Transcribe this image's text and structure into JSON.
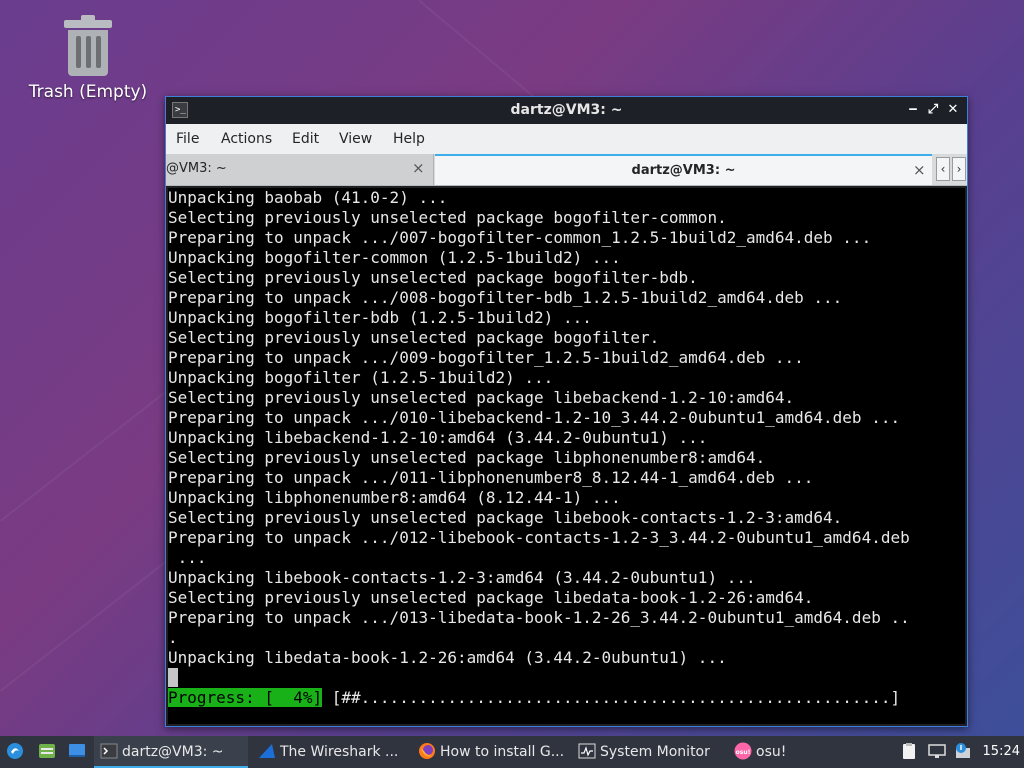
{
  "desktop": {
    "trash_label": "Trash (Empty)"
  },
  "window": {
    "title": "dartz@VM3: ~",
    "menu": [
      "File",
      "Actions",
      "Edit",
      "View",
      "Help"
    ],
    "tabs": [
      {
        "label": "@VM3: ~",
        "active": false
      },
      {
        "label": "dartz@VM3: ~",
        "active": true
      }
    ],
    "tab_close_glyph": "×",
    "buttons": {
      "minimize": "‒",
      "maximize": "⤢",
      "close": "✕"
    }
  },
  "terminal": {
    "lines": [
      "Unpacking baobab (41.0-2) ...",
      "Selecting previously unselected package bogofilter-common.",
      "Preparing to unpack .../007-bogofilter-common_1.2.5-1build2_amd64.deb ...",
      "Unpacking bogofilter-common (1.2.5-1build2) ...",
      "Selecting previously unselected package bogofilter-bdb.",
      "Preparing to unpack .../008-bogofilter-bdb_1.2.5-1build2_amd64.deb ...",
      "Unpacking bogofilter-bdb (1.2.5-1build2) ...",
      "Selecting previously unselected package bogofilter.",
      "Preparing to unpack .../009-bogofilter_1.2.5-1build2_amd64.deb ...",
      "Unpacking bogofilter (1.2.5-1build2) ...",
      "Selecting previously unselected package libebackend-1.2-10:amd64.",
      "Preparing to unpack .../010-libebackend-1.2-10_3.44.2-0ubuntu1_amd64.deb ...",
      "Unpacking libebackend-1.2-10:amd64 (3.44.2-0ubuntu1) ...",
      "Selecting previously unselected package libphonenumber8:amd64.",
      "Preparing to unpack .../011-libphonenumber8_8.12.44-1_amd64.deb ...",
      "Unpacking libphonenumber8:amd64 (8.12.44-1) ...",
      "Selecting previously unselected package libebook-contacts-1.2-3:amd64.",
      "Preparing to unpack .../012-libebook-contacts-1.2-3_3.44.2-0ubuntu1_amd64.deb",
      " ...",
      "Unpacking libebook-contacts-1.2-3:amd64 (3.44.2-0ubuntu1) ...",
      "Selecting previously unselected package libedata-book-1.2-26:amd64.",
      "Preparing to unpack .../013-libedata-book-1.2-26_3.44.2-0ubuntu1_amd64.deb ..",
      ".",
      "Unpacking libedata-book-1.2-26:amd64 (3.44.2-0ubuntu1) ..."
    ],
    "progress_label": "Progress: [  4%]",
    "progress_bar": " [##.......................................................]",
    "progress_percent": 4
  },
  "taskbar": {
    "items": [
      {
        "label": "dartz@VM3: ~",
        "icon": "terminal-icon",
        "active": true
      },
      {
        "label": "The Wireshark ...",
        "icon": "wireshark-icon",
        "active": false
      },
      {
        "label": "How to install G...",
        "icon": "firefox-icon",
        "active": false
      },
      {
        "label": "System Monitor",
        "icon": "system-monitor-icon",
        "active": false
      },
      {
        "label": "osu!",
        "icon": "osu-icon",
        "active": false
      }
    ],
    "osu_icon_text": "osu!",
    "clock": "15:24"
  },
  "colors": {
    "accent": "#3daee9",
    "progress_green": "#18b218",
    "terminal_bg": "#000000",
    "taskbar_bg": "#2f343f"
  }
}
